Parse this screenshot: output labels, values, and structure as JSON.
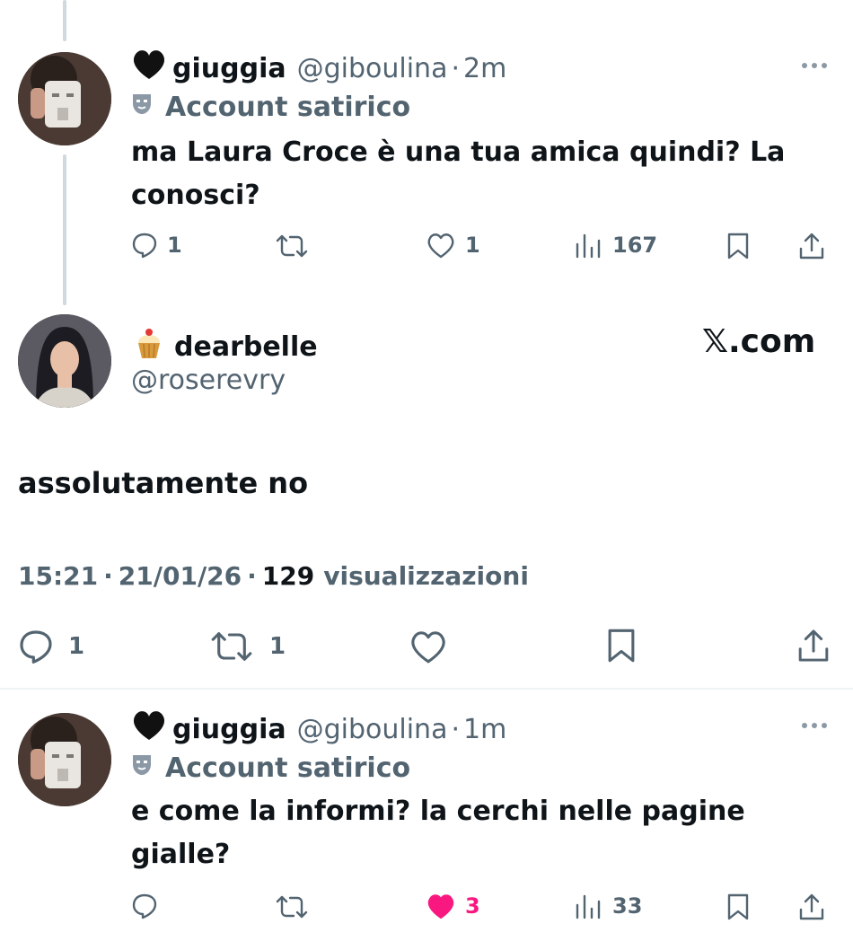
{
  "tweet1": {
    "display_name": "giuggia",
    "handle": "@giboulina",
    "separator": "·",
    "time": "2m",
    "label": "Account satirico",
    "text_line1": "ma Laura Croce è una tua amica quindi? La",
    "text_line2": "conosci?",
    "replies": "1",
    "likes": "1",
    "views": "167"
  },
  "main_tweet": {
    "display_name": "dearbelle",
    "handle": "@roserevry",
    "watermark": "𝕏.com",
    "text": "assolutamente no",
    "time": "15:21",
    "sep1": "·",
    "date": "21/01/26",
    "sep2": "·",
    "views_count": "129",
    "views_label": "visualizzazioni",
    "replies": "1",
    "reposts": "1"
  },
  "tweet3": {
    "display_name": "giuggia",
    "handle": "@giboulina",
    "separator": "·",
    "time": "1m",
    "label": "Account satirico",
    "text_line1": "e come la informi? la cerchi nelle pagine",
    "text_line2": "gialle?",
    "likes": "3",
    "views": "33"
  },
  "colors": {
    "text": "#0f1419",
    "muted": "#536471",
    "like_pink": "#f91880",
    "divider": "#eff3f4"
  },
  "icons": [
    "black-heart-emoji-icon",
    "satire-mask-icon",
    "cupcake-emoji-icon",
    "reply-icon",
    "repost-icon",
    "like-icon",
    "views-icon",
    "bookmark-icon",
    "share-icon",
    "more-icon"
  ]
}
